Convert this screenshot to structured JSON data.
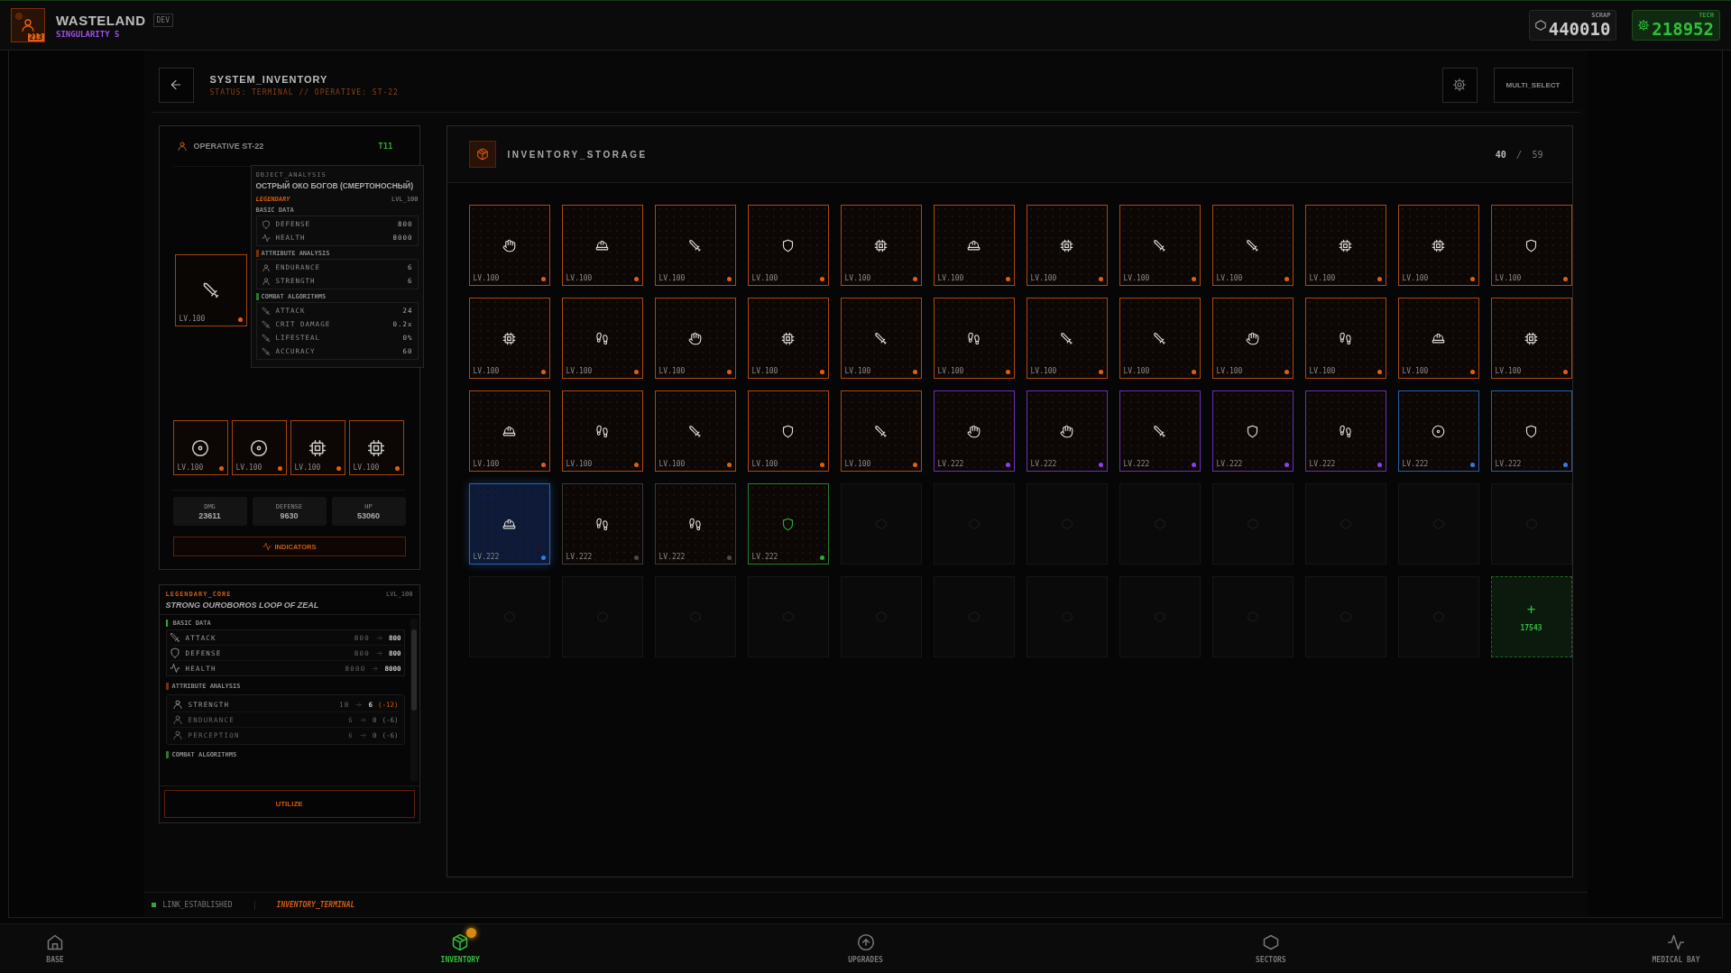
{
  "top_bar": {
    "avatar_badge": "213",
    "title": "WASTELAND",
    "env_tag": "DEV",
    "subtitle": "SINGULARITY 5",
    "currencies": [
      {
        "kind": "scrap",
        "label": "SCRAP",
        "value": "440010"
      },
      {
        "kind": "tech",
        "label": "TECH",
        "value": "218952"
      }
    ]
  },
  "header": {
    "title": "SYSTEM_INVENTORY",
    "status": "STATUS: TERMINAL // OPERATIVE: ST-22",
    "multi_select": "MULTI_SELECT"
  },
  "operative": {
    "name": "OPERATIVE ST-22",
    "tier": "T11",
    "equipment": [
      {
        "kind": "sword",
        "lv": "LV.100",
        "color": "#e0600f"
      }
    ],
    "accessories": [
      {
        "kind": "target",
        "lv": "LV.100",
        "color": "#e0600f"
      },
      {
        "kind": "target",
        "lv": "LV.100",
        "color": "#e0600f"
      },
      {
        "kind": "chip",
        "lv": "LV.100",
        "color": "#e0600f"
      },
      {
        "kind": "chip",
        "lv": "LV.100",
        "color": "#e0600f"
      }
    ],
    "stats": [
      {
        "label": "DMG",
        "value": "23611"
      },
      {
        "label": "DEFENSE",
        "value": "9630"
      },
      {
        "label": "HP",
        "value": "53060"
      }
    ],
    "indicators_button": "INDICATORS",
    "tooltip": {
      "caption": "OBJECT_ANALYSIS",
      "title": "ОСТРЫЙ ОКО БОГОВ (СМЕРТОНОСНЫЙ)",
      "rarity": "LEGENDARY",
      "lvl": "LVL_100",
      "sections": [
        {
          "kind": "basic",
          "title": "BASIC DATA",
          "rows": [
            {
              "kind": "shield",
              "label": "DEFENSE",
              "value": "800"
            },
            {
              "kind": "activity",
              "label": "HEALTH",
              "value": "8000"
            }
          ]
        },
        {
          "kind": "attribute",
          "title": "ATTRIBUTE ANALYSIS",
          "rows": [
            {
              "kind": "user",
              "label": "ENDURANCE",
              "value": "6"
            },
            {
              "kind": "user",
              "label": "STRENGTH",
              "value": "6"
            }
          ]
        },
        {
          "kind": "combat",
          "title": "COMBAT ALGORITHMS",
          "rows": [
            {
              "kind": "sword",
              "label": "ATTACK",
              "value": "24"
            },
            {
              "kind": "sword",
              "label": "CRIT DAMAGE",
              "value": "0.2x"
            },
            {
              "kind": "sword",
              "label": "LIFESTEAL",
              "value": "0%"
            },
            {
              "kind": "sword",
              "label": "ACCURACY",
              "value": "60"
            }
          ]
        }
      ]
    }
  },
  "item_detail": {
    "rarity": "LEGENDARY_CORE",
    "lvl": "LVL_100",
    "title": "STRONG OUROBOROS LOOP OF ZEAL",
    "basic_title": "BASIC DATA",
    "basic": [
      {
        "kind": "sword",
        "label": "ATTACK",
        "from": "800",
        "to": "800"
      },
      {
        "kind": "shield",
        "label": "DEFENSE",
        "from": "800",
        "to": "800"
      },
      {
        "kind": "activity",
        "label": "HEALTH",
        "from": "8000",
        "to": "8000"
      }
    ],
    "attribute_title": "ATTRIBUTE ANALYSIS",
    "attributes": [
      {
        "label": "STRENGTH",
        "from": "18",
        "to": "6",
        "delta": "(-12)",
        "dimmed": false
      },
      {
        "label": "ENDURANCE",
        "from": "6",
        "to": "0",
        "delta": "(-6)",
        "dimmed": true
      },
      {
        "label": "PERCEPTION",
        "from": "6",
        "to": "0",
        "delta": "(-6)",
        "dimmed": true
      }
    ],
    "combat_title": "COMBAT ALGORITHMS",
    "utilize_button": "UTILIZE"
  },
  "inventory": {
    "title": "INVENTORY_STORAGE",
    "count": "40",
    "separator": "/",
    "capacity": "59",
    "cells": [
      {
        "kind": "hand",
        "lv": "LV.100",
        "color": "#e0600f",
        "selected": false
      },
      {
        "kind": "helmet",
        "lv": "LV.100",
        "color": "#e0600f",
        "selected": false
      },
      {
        "kind": "sword",
        "lv": "LV.100",
        "color": "#e0600f",
        "selected": false
      },
      {
        "kind": "shield",
        "lv": "LV.100",
        "color": "#e0600f",
        "selected": false
      },
      {
        "kind": "chip",
        "lv": "LV.100",
        "color": "#e0600f",
        "selected": false
      },
      {
        "kind": "helmet",
        "lv": "LV.100",
        "color": "#e0600f",
        "selected": false
      },
      {
        "kind": "chip",
        "lv": "LV.100",
        "color": "#e0600f",
        "selected": false
      },
      {
        "kind": "sword",
        "lv": "LV.100",
        "color": "#e0600f",
        "selected": false
      },
      {
        "kind": "sword",
        "lv": "LV.100",
        "color": "#e0600f",
        "selected": false
      },
      {
        "kind": "chip",
        "lv": "LV.100",
        "color": "#e0600f",
        "selected": false
      },
      {
        "kind": "chip",
        "lv": "LV.100",
        "color": "#e0600f",
        "selected": false
      },
      {
        "kind": "shield",
        "lv": "LV.100",
        "color": "#e0600f",
        "selected": false
      },
      {
        "kind": "chip",
        "lv": "LV.100",
        "color": "#e0600f",
        "selected": false
      },
      {
        "kind": "boots",
        "lv": "LV.100",
        "color": "#e0600f",
        "selected": false
      },
      {
        "kind": "hand",
        "lv": "LV.100",
        "color": "#e0600f",
        "selected": false
      },
      {
        "kind": "chip",
        "lv": "LV.100",
        "color": "#e0600f",
        "selected": false
      },
      {
        "kind": "sword",
        "lv": "LV.100",
        "color": "#e0600f",
        "selected": false
      },
      {
        "kind": "boots",
        "lv": "LV.100",
        "color": "#e0600f",
        "selected": false
      },
      {
        "kind": "sword",
        "lv": "LV.100",
        "color": "#e0600f",
        "selected": false
      },
      {
        "kind": "sword",
        "lv": "LV.100",
        "color": "#e0600f",
        "selected": false
      },
      {
        "kind": "hand",
        "lv": "LV.100",
        "color": "#e0600f",
        "selected": false
      },
      {
        "kind": "boots",
        "lv": "LV.100",
        "color": "#e0600f",
        "selected": false
      },
      {
        "kind": "helmet",
        "lv": "LV.100",
        "color": "#e0600f",
        "selected": false
      },
      {
        "kind": "chip",
        "lv": "LV.100",
        "color": "#e0600f",
        "selected": false
      },
      {
        "kind": "helmet",
        "lv": "LV.100",
        "color": "#e0600f",
        "selected": false
      },
      {
        "kind": "boots",
        "lv": "LV.100",
        "color": "#e0600f",
        "selected": false
      },
      {
        "kind": "sword",
        "lv": "LV.100",
        "color": "#e0600f",
        "selected": false
      },
      {
        "kind": "shield",
        "lv": "LV.100",
        "color": "#e0600f",
        "selected": false
      },
      {
        "kind": "sword",
        "lv": "LV.100",
        "color": "#e0600f",
        "selected": false
      },
      {
        "kind": "hand",
        "lv": "LV.222",
        "color": "#8a3ff0",
        "selected": false
      },
      {
        "kind": "hand",
        "lv": "LV.222",
        "color": "#8a3ff0",
        "selected": false
      },
      {
        "kind": "sword",
        "lv": "LV.222",
        "color": "#8a3ff0",
        "selected": false
      },
      {
        "kind": "shield",
        "lv": "LV.222",
        "color": "#8a3ff0",
        "selected": false
      },
      {
        "kind": "boots",
        "lv": "LV.222",
        "color": "#8a3ff0",
        "selected": false
      },
      {
        "kind": "target",
        "lv": "LV.222",
        "color": "#2f7fe0",
        "selected": false
      },
      {
        "kind": "shield",
        "lv": "LV.222",
        "color": "#2f7fe0",
        "selected": false
      },
      {
        "kind": "helmet",
        "lv": "LV.222",
        "color": "#2f7fe0",
        "selected": true
      },
      {
        "kind": "boots",
        "lv": "LV.222",
        "color": "#4a4a4a",
        "selected": false
      },
      {
        "kind": "boots",
        "lv": "LV.222",
        "color": "#4a4a4a",
        "selected": false
      },
      {
        "kind": "shield",
        "lv": "LV.222",
        "color": "#2fa83a",
        "selected": false
      },
      {
        "kind": "empty"
      },
      {
        "kind": "empty"
      },
      {
        "kind": "empty"
      },
      {
        "kind": "empty"
      },
      {
        "kind": "empty"
      },
      {
        "kind": "empty"
      },
      {
        "kind": "empty"
      },
      {
        "kind": "empty"
      },
      {
        "kind": "empty"
      },
      {
        "kind": "empty"
      },
      {
        "kind": "empty"
      },
      {
        "kind": "empty"
      },
      {
        "kind": "empty"
      },
      {
        "kind": "empty"
      },
      {
        "kind": "empty"
      },
      {
        "kind": "empty"
      },
      {
        "kind": "empty"
      },
      {
        "kind": "empty"
      },
      {
        "kind": "empty"
      },
      {
        "kind": "add",
        "symbol": "+",
        "cost": "17543"
      }
    ]
  },
  "status_bar": {
    "link": "LINK_ESTABLISHED",
    "terminal": "INVENTORY_TERMINAL"
  },
  "nav": [
    {
      "kind": "home",
      "label": "BASE",
      "selected": false,
      "badge": false
    },
    {
      "kind": "package",
      "label": "INVENTORY",
      "selected": true,
      "badge": true
    },
    {
      "kind": "arrow-up",
      "label": "UPGRADES",
      "selected": false,
      "badge": false
    },
    {
      "kind": "hexagon",
      "label": "SECTORS",
      "selected": false,
      "badge": false
    },
    {
      "kind": "activity",
      "label": "MEDICAL BAY",
      "selected": false,
      "badge": false
    }
  ]
}
